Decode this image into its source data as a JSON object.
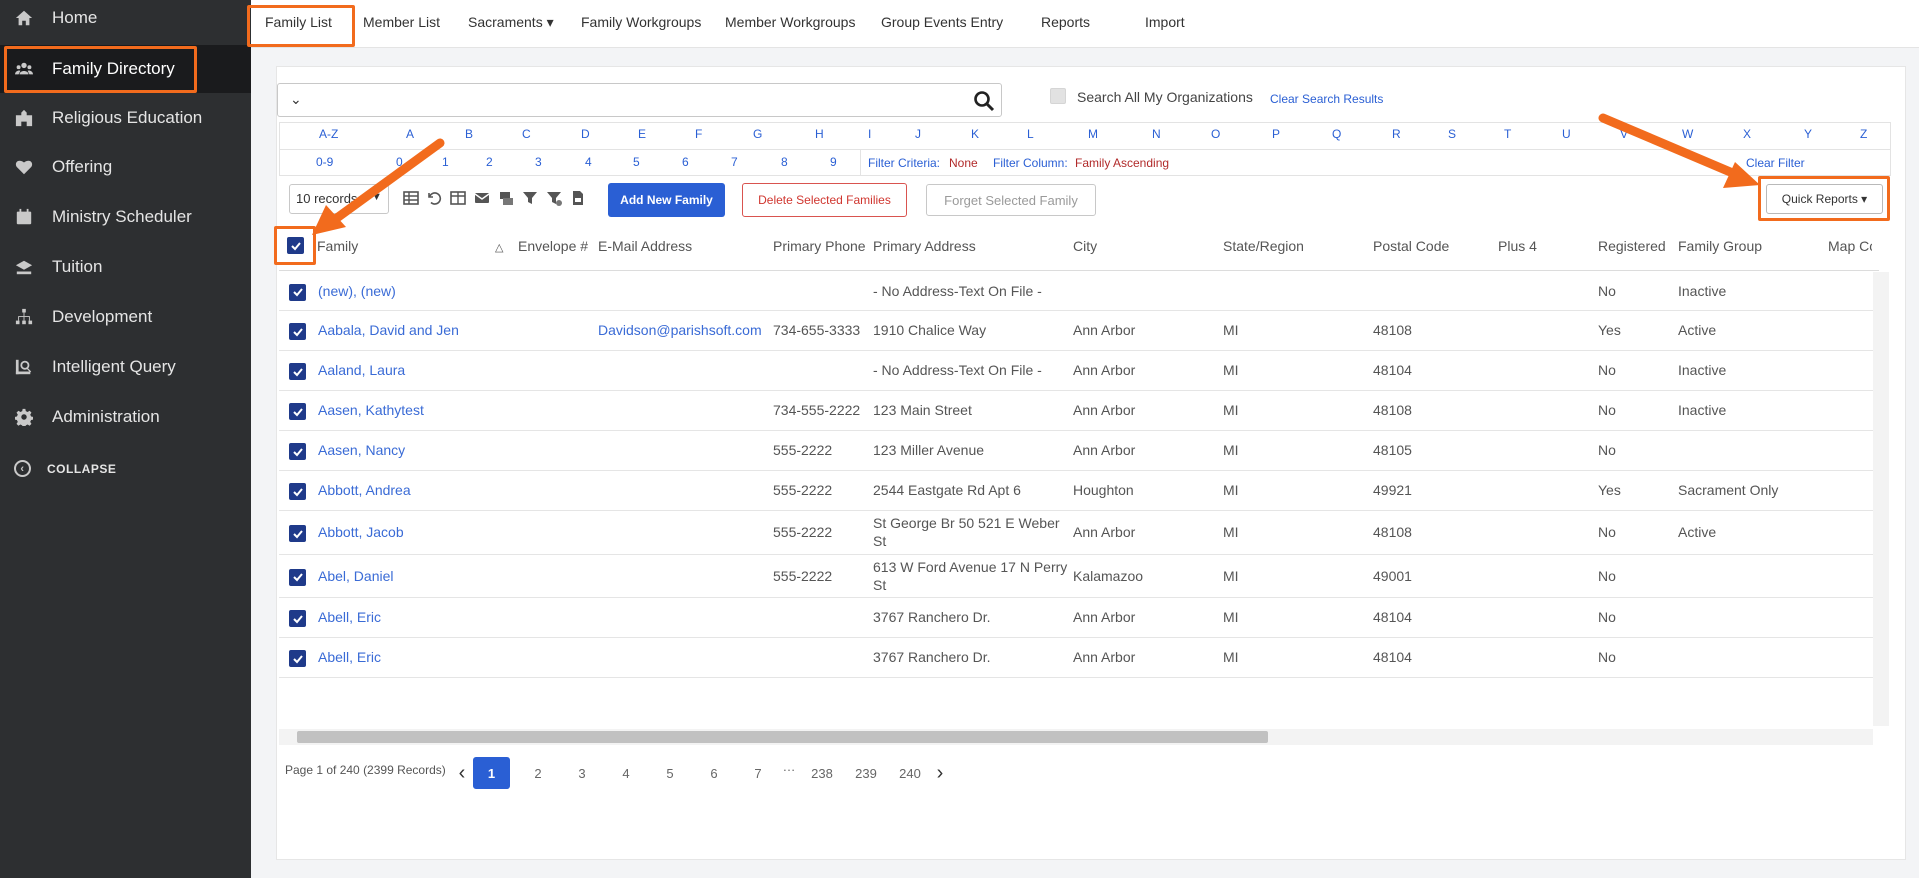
{
  "sidebar": {
    "items": [
      {
        "label": "Home",
        "icon": "home-icon"
      },
      {
        "label": "Family Directory",
        "icon": "users-icon"
      },
      {
        "label": "Religious Education",
        "icon": "school-icon"
      },
      {
        "label": "Offering",
        "icon": "heart-icon"
      },
      {
        "label": "Ministry Scheduler",
        "icon": "calendar-icon"
      },
      {
        "label": "Tuition",
        "icon": "tuition-icon"
      },
      {
        "label": "Development",
        "icon": "sitemap-icon"
      },
      {
        "label": "Intelligent Query",
        "icon": "query-icon"
      },
      {
        "label": "Administration",
        "icon": "gear-icon"
      }
    ],
    "collapse_label": "COLLAPSE"
  },
  "tabs": [
    "Family List",
    "Member List",
    "Sacraments ▾",
    "Family Workgroups",
    "Member Workgroups",
    "Group Events Entry",
    "Reports",
    "Import"
  ],
  "search": {
    "all_orgs_label": "Search All My Organizations",
    "clear_results": "Clear Search Results"
  },
  "alpha": {
    "row1": [
      "A-Z",
      "A",
      "B",
      "C",
      "D",
      "E",
      "F",
      "G",
      "H",
      "I",
      "J",
      "K",
      "L",
      "M",
      "N",
      "O",
      "P",
      "Q",
      "R",
      "S",
      "T",
      "U",
      "V",
      "W",
      "X",
      "Y",
      "Z"
    ],
    "row2": [
      "0-9",
      "0",
      "1",
      "2",
      "3",
      "4",
      "5",
      "6",
      "7",
      "8",
      "9"
    ],
    "filter_criteria_label": "Filter Criteria:",
    "filter_criteria_value": "None",
    "filter_column_label": "Filter Column:",
    "filter_column_value": "Family Ascending",
    "clear_filter": "Clear Filter"
  },
  "toolbar": {
    "records_value": "10 records",
    "add_new": "Add New Family",
    "delete_selected": "Delete Selected Families",
    "forget_selected": "Forget Selected Family",
    "quick_reports": "Quick Reports ▾"
  },
  "table": {
    "headers": [
      "Family",
      "Envelope #",
      "E-Mail Address",
      "Primary Phone",
      "Primary Address",
      "City",
      "State/Region",
      "Postal Code",
      "Plus 4",
      "Registered",
      "Family Group",
      "Map Co"
    ],
    "rows": [
      {
        "family": "(new), (new)",
        "email": "",
        "phone": "",
        "address": "- No Address-Text On File -",
        "city": "",
        "state": "",
        "postal": "",
        "registered": "No",
        "group": "Inactive"
      },
      {
        "family": "Aabala, David and Jen",
        "email": "Davidson@parishsoft.com",
        "phone": "734-655-3333",
        "address": "1910 Chalice Way",
        "city": "Ann Arbor",
        "state": "MI",
        "postal": "48108",
        "registered": "Yes",
        "group": "Active"
      },
      {
        "family": "Aaland, Laura",
        "email": "",
        "phone": "",
        "address": "- No Address-Text On File -",
        "city": "Ann Arbor",
        "state": "MI",
        "postal": "48104",
        "registered": "No",
        "group": "Inactive"
      },
      {
        "family": "Aasen, Kathytest",
        "email": "",
        "phone": "734-555-2222",
        "address": "123 Main Street",
        "city": "Ann Arbor",
        "state": "MI",
        "postal": "48108",
        "registered": "No",
        "group": "Inactive"
      },
      {
        "family": "Aasen, Nancy",
        "email": "",
        "phone": "555-2222",
        "address": "123 Miller Avenue",
        "city": "Ann Arbor",
        "state": "MI",
        "postal": "48105",
        "registered": "No",
        "group": ""
      },
      {
        "family": "Abbott, Andrea",
        "email": "",
        "phone": "555-2222",
        "address": "2544 Eastgate Rd Apt 6",
        "city": "Houghton",
        "state": "MI",
        "postal": "49921",
        "registered": "Yes",
        "group": "Sacrament Only"
      },
      {
        "family": "Abbott, Jacob",
        "email": "",
        "phone": "555-2222",
        "address": "St George Br 50 521 E Weber St",
        "city": "Ann Arbor",
        "state": "MI",
        "postal": "48108",
        "registered": "No",
        "group": "Active"
      },
      {
        "family": "Abel, Daniel",
        "email": "",
        "phone": "555-2222",
        "address": "613 W Ford Avenue 17 N Perry St",
        "city": "Kalamazoo",
        "state": "MI",
        "postal": "49001",
        "registered": "No",
        "group": ""
      },
      {
        "family": "Abell, Eric",
        "email": "",
        "phone": "",
        "address": "3767 Ranchero Dr.",
        "city": "Ann Arbor",
        "state": "MI",
        "postal": "48104",
        "registered": "No",
        "group": ""
      },
      {
        "family": "Abell, Eric",
        "email": "",
        "phone": "",
        "address": "3767 Ranchero Dr.",
        "city": "Ann Arbor",
        "state": "MI",
        "postal": "48104",
        "registered": "No",
        "group": ""
      }
    ]
  },
  "pager": {
    "summary": "Page 1 of 240 (2399 Records)",
    "pages": [
      "1",
      "2",
      "3",
      "4",
      "5",
      "6",
      "7",
      "…",
      "238",
      "239",
      "240"
    ],
    "current": "1"
  },
  "colors": {
    "accent": "#2a5fd4",
    "highlight": "#f26b1d",
    "sidebar": "#2d2f31",
    "checkbox": "#1f3a8a"
  }
}
